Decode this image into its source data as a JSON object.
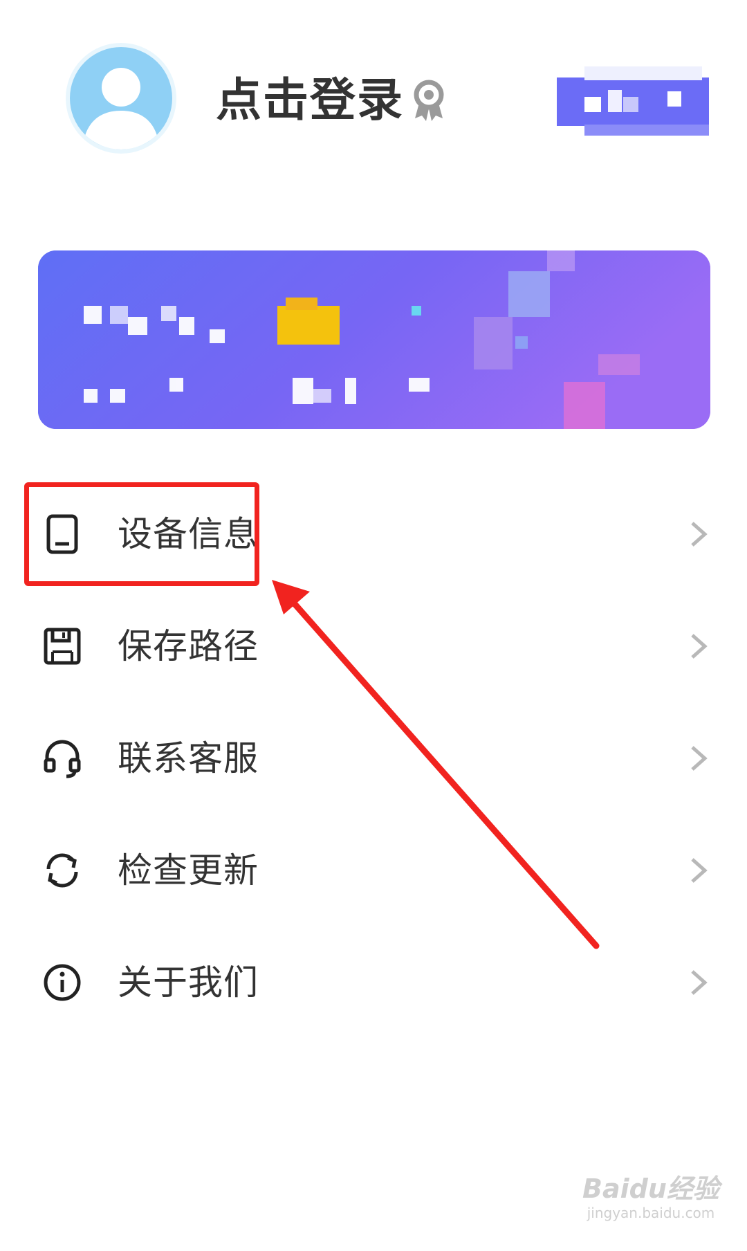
{
  "header": {
    "login_label": "点击登录"
  },
  "menu": {
    "items": [
      {
        "label": "设备信息",
        "icon": "tablet-icon"
      },
      {
        "label": "保存路径",
        "icon": "floppy-disk-icon"
      },
      {
        "label": "联系客服",
        "icon": "headset-icon"
      },
      {
        "label": "检查更新",
        "icon": "refresh-icon"
      },
      {
        "label": "关于我们",
        "icon": "info-icon"
      }
    ]
  },
  "annotation": {
    "highlight_color": "#f1231f"
  },
  "watermark": {
    "brand": "Baidu经验",
    "url": "jingyan.baidu.com"
  },
  "colors": {
    "banner_start": "#5f6ff5",
    "banner_end": "#9a6cf5",
    "vip_badge": "#6b6cf6",
    "text": "#333333"
  }
}
